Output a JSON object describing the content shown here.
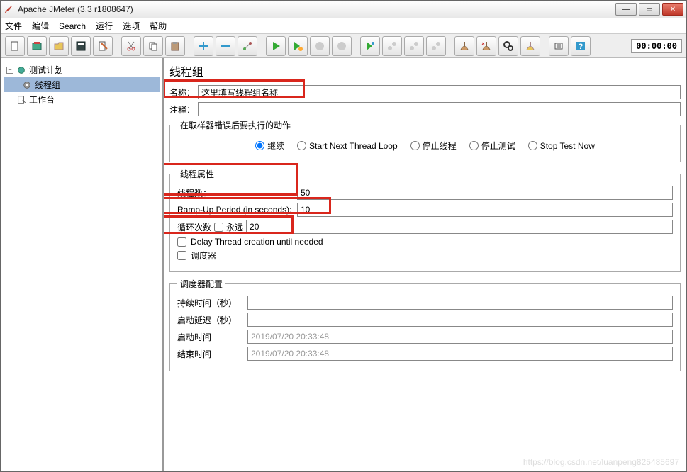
{
  "window": {
    "title": "Apache JMeter (3.3 r1808647)",
    "timer": "00:00:00"
  },
  "menu": {
    "file": "文件",
    "edit": "编辑",
    "search": "Search",
    "run": "运行",
    "options": "选项",
    "help": "帮助"
  },
  "tree": {
    "root": "测试计划",
    "thread_group": "线程组",
    "workbench": "工作台"
  },
  "panel": {
    "title": "线程组",
    "name_label": "名称：",
    "name_value": "这里填写线程组名称",
    "comment_label": "注释：",
    "comment_value": "",
    "error_action": {
      "legend": "在取样器错误后要执行的动作",
      "continue": "继续",
      "start_next": "Start Next Thread Loop",
      "stop_thread": "停止线程",
      "stop_test": "停止测试",
      "stop_now": "Stop Test Now"
    },
    "thread_props": {
      "legend": "线程属性",
      "threads_label": "线程数：",
      "threads_value": "50",
      "rampup_label": "Ramp-Up Period (in seconds):",
      "rampup_value": "10",
      "loop_label": "循环次数",
      "forever": "永远",
      "loop_value": "20",
      "delay_creation": "Delay Thread creation until needed",
      "scheduler": "调度器"
    },
    "scheduler": {
      "legend": "调度器配置",
      "duration_label": "持续时间（秒）",
      "delay_label": "启动延迟（秒）",
      "start_label": "启动时间",
      "start_value": "2019/07/20 20:33:48",
      "end_label": "结束时间",
      "end_value": "2019/07/20 20:33:48"
    }
  },
  "watermark": "https://blog.csdn.net/luanpeng825485697"
}
